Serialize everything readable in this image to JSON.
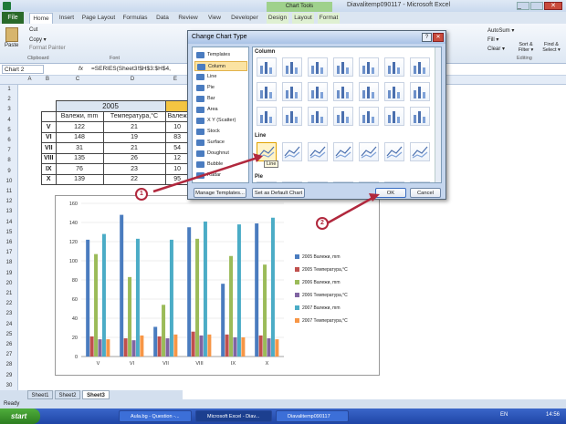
{
  "window": {
    "title": "Diavalitemp090117 - Microsoft Excel",
    "contextual_group": "Chart Tools"
  },
  "ribbon": {
    "tabs": [
      "File",
      "Home",
      "Insert",
      "Page Layout",
      "Formulas",
      "Data",
      "Review",
      "View",
      "Developer",
      "Design",
      "Layout",
      "Format"
    ],
    "clipboard": {
      "paste": "Paste",
      "cut": "Cut",
      "copy": "Copy ▾",
      "format_painter": "Format Painter",
      "group": "Clipboard"
    },
    "font_group": "Font",
    "editing": {
      "autosum": "AutoSum ▾",
      "fill": "Fill ▾",
      "clear": "Clear ▾",
      "sort": "Sort & Filter ▾",
      "find": "Find & Select ▾",
      "group": "Editing"
    }
  },
  "formula_bar": {
    "name_box": "Chart 2",
    "fx": "fx",
    "formula": "=SERIES(Sheet3!$H$3:$H$4,"
  },
  "columns": [
    "A",
    "B",
    "C",
    "D",
    "E"
  ],
  "rows": [
    "1",
    "2",
    "3",
    "4",
    "5",
    "6",
    "7",
    "8",
    "9",
    "10",
    "11",
    "12",
    "13",
    "14",
    "15",
    "16",
    "17",
    "18",
    "19",
    "20",
    "21",
    "22",
    "23",
    "24",
    "25",
    "26",
    "27",
    "28",
    "29",
    "30"
  ],
  "table": {
    "year": "2005",
    "headers": [
      "Валежи, mm",
      "Температура,°C",
      "Валеж"
    ],
    "rows": [
      {
        "m": "V",
        "a": "122",
        "b": "21",
        "c": "10"
      },
      {
        "m": "VI",
        "a": "148",
        "b": "19",
        "c": "83"
      },
      {
        "m": "VII",
        "a": "31",
        "b": "21",
        "c": "54"
      },
      {
        "m": "VIII",
        "a": "135",
        "b": "26",
        "c": "12"
      },
      {
        "m": "IX",
        "a": "76",
        "b": "23",
        "c": "10"
      },
      {
        "m": "X",
        "a": "139",
        "b": "22",
        "c": "95"
      }
    ]
  },
  "chart_data": {
    "type": "bar",
    "categories": [
      "V",
      "VI",
      "VII",
      "VIII",
      "IX",
      "X"
    ],
    "ylim": [
      0,
      160
    ],
    "yticks": [
      "0",
      "20",
      "40",
      "60",
      "80",
      "100",
      "120",
      "140",
      "160"
    ],
    "series": [
      {
        "name": "2005 Валежи, mm",
        "color": "#4a7cbf",
        "values": [
          122,
          148,
          31,
          135,
          76,
          139
        ]
      },
      {
        "name": "2005 Температура,°C",
        "color": "#c0504d",
        "values": [
          21,
          19,
          21,
          26,
          23,
          22
        ]
      },
      {
        "name": "2006 Валежи, mm",
        "color": "#9bbb59",
        "values": [
          107,
          83,
          54,
          123,
          105,
          96
        ]
      },
      {
        "name": "2006 Температура,°C",
        "color": "#8064a2",
        "values": [
          18,
          17,
          19,
          22,
          20,
          19
        ]
      },
      {
        "name": "2007 Валежи, mm",
        "color": "#4bacc6",
        "values": [
          128,
          123,
          122,
          141,
          138,
          145
        ]
      },
      {
        "name": "2007 Температура,°C",
        "color": "#f79646",
        "values": [
          18,
          22,
          23,
          23,
          20,
          18
        ]
      }
    ]
  },
  "dialog": {
    "title": "Change Chart Type",
    "help": "?",
    "close": "✕",
    "types": [
      "Templates",
      "Column",
      "Line",
      "Pie",
      "Bar",
      "Area",
      "X Y (Scatter)",
      "Stock",
      "Surface",
      "Doughnut",
      "Bubble",
      "Radar"
    ],
    "selected_type": "Column",
    "sections": {
      "column": "Column",
      "line": "Line",
      "pie": "Pie"
    },
    "tooltip": "Line",
    "manage_templates": "Manage Templates...",
    "set_default": "Set as Default Chart",
    "ok": "OK",
    "cancel": "Cancel"
  },
  "callouts": {
    "one": "1",
    "two": "2"
  },
  "sheets": [
    "Sheet1",
    "Sheet2",
    "Sheet3"
  ],
  "active_sheet": "Sheet3",
  "status": "Ready",
  "taskbar": {
    "start": "start",
    "items": [
      "Aula.bg - Question -...",
      "Microsoft Excel - Diav...",
      "Diavalitemp090117"
    ],
    "lang": "EN",
    "clock": "14:56"
  }
}
